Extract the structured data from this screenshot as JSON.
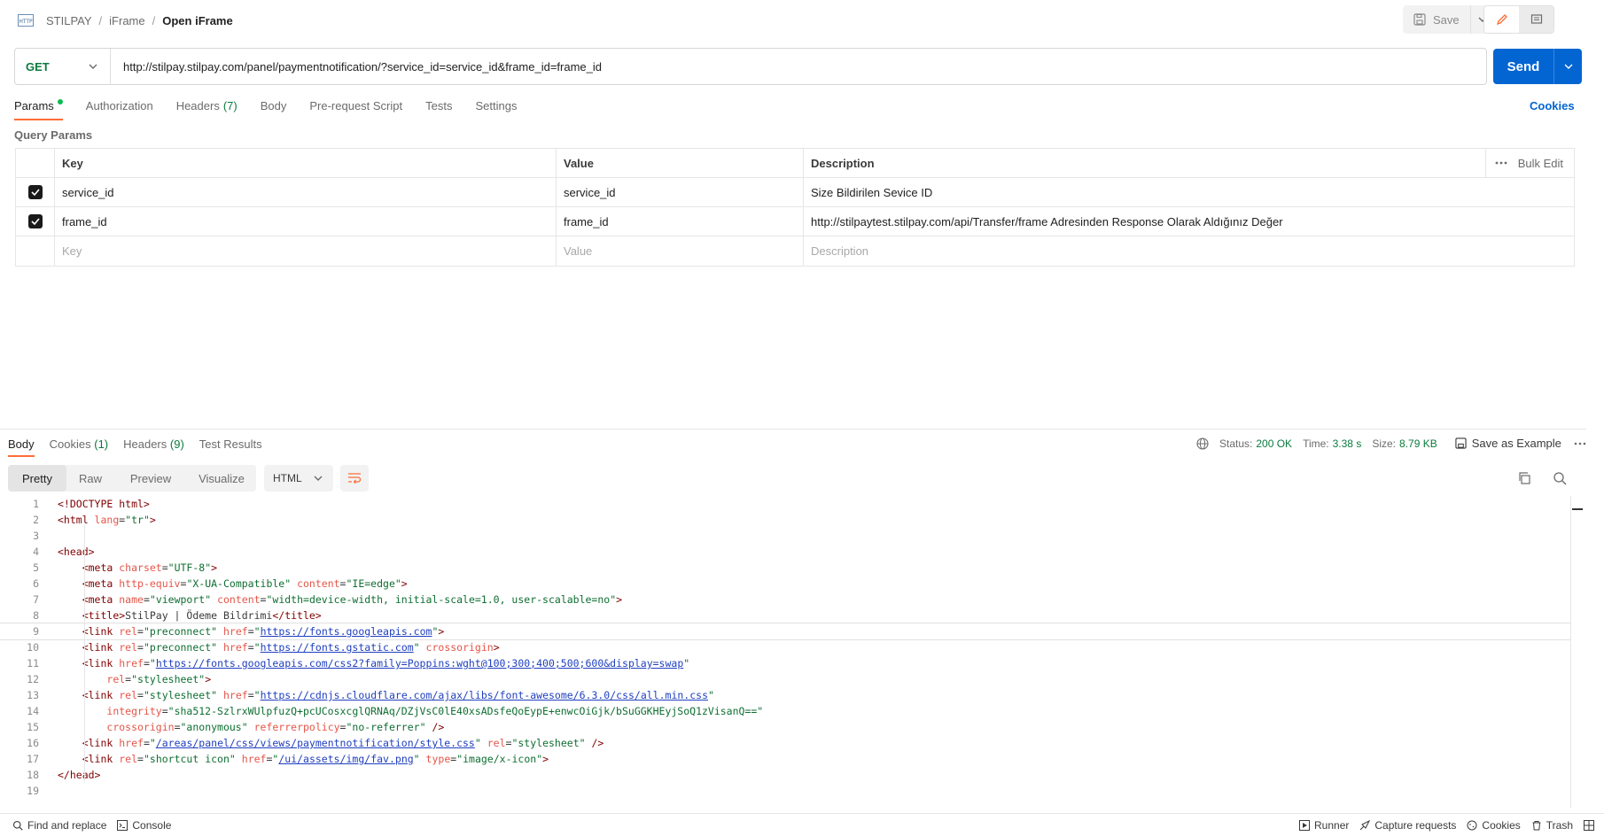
{
  "header": {
    "breadcrumb": [
      "STILPAY",
      "iFrame"
    ],
    "current": "Open iFrame",
    "save_label": "Save"
  },
  "request": {
    "method": "GET",
    "url": "http://stilpay.stilpay.com/panel/paymentnotification/?service_id=service_id&frame_id=frame_id",
    "send_label": "Send",
    "tabs": [
      {
        "label": "Params",
        "active": true
      },
      {
        "label": "Authorization"
      },
      {
        "label": "Headers",
        "count": "(7)"
      },
      {
        "label": "Body"
      },
      {
        "label": "Pre-request Script"
      },
      {
        "label": "Tests"
      },
      {
        "label": "Settings"
      }
    ],
    "cookies_label": "Cookies",
    "query_params_title": "Query Params",
    "table": {
      "headers": {
        "key": "Key",
        "value": "Value",
        "description": "Description",
        "bulk_edit": "Bulk Edit"
      },
      "rows": [
        {
          "key": "service_id",
          "value": "service_id",
          "description": "Size Bildirilen Sevice ID"
        },
        {
          "key": "frame_id",
          "value": "frame_id",
          "description": "http://stilpaytest.stilpay.com/api/Transfer/frame Adresinden Response Olarak Aldığınız Değer"
        }
      ],
      "placeholder": {
        "key": "Key",
        "value": "Value",
        "description": "Description"
      }
    }
  },
  "response": {
    "tabs": [
      {
        "label": "Body",
        "active": true
      },
      {
        "label": "Cookies",
        "count": "(1)"
      },
      {
        "label": "Headers",
        "count": "(9)"
      },
      {
        "label": "Test Results"
      }
    ],
    "status_label": "Status:",
    "status_value": "200 OK",
    "time_label": "Time:",
    "time_value": "3.38 s",
    "size_label": "Size:",
    "size_value": "8.79 KB",
    "save_example": "Save as Example",
    "formats": [
      "Pretty",
      "Raw",
      "Preview",
      "Visualize"
    ],
    "language": "HTML"
  },
  "code_lines": [
    "1",
    "2",
    "3",
    "4",
    "5",
    "6",
    "7",
    "8",
    "9",
    "10",
    "11",
    "12",
    "13",
    "14",
    "15",
    "16",
    "17",
    "18",
    "19"
  ],
  "footer": {
    "find_replace": "Find and replace",
    "console": "Console",
    "runner": "Runner",
    "capture": "Capture requests",
    "cookies": "Cookies",
    "trash": "Trash"
  },
  "colors": {
    "accent": "#ff6c37",
    "send": "#0265d2",
    "get": "#0b7b3e",
    "success": "#0cbb52"
  }
}
